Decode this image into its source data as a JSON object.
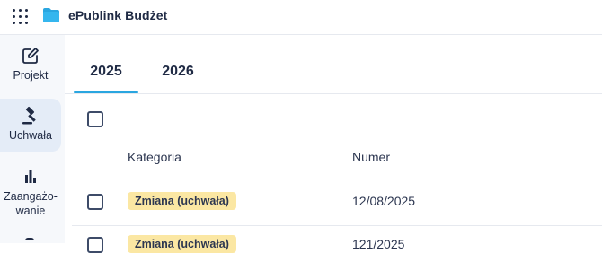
{
  "header": {
    "app_title": "ePublink Budżet",
    "apps_icon": "apps-grid-icon",
    "logo_icon": "folder-icon",
    "logo_color": "#2aa6e0"
  },
  "sidebar": {
    "items": [
      {
        "label": "Projekt",
        "icon": "edit-icon",
        "active": false
      },
      {
        "label": "Uchwała",
        "icon": "gavel-icon",
        "active": true
      },
      {
        "label": "Zaangażo-\nwanie",
        "label_line1": "Zaangażo-",
        "label_line2": "wanie",
        "icon": "bar-chart-icon",
        "active": false
      }
    ]
  },
  "tabs": [
    {
      "label": "2025",
      "active": true
    },
    {
      "label": "2026",
      "active": false
    }
  ],
  "accent_color": "#2aa6e0",
  "table": {
    "columns": [
      "Kategoria",
      "Numer"
    ],
    "rows": [
      {
        "category": "Zmiana (uchwała)",
        "number": "12/08/2025"
      },
      {
        "category": "Zmiana (uchwała)",
        "number": "121/2025"
      }
    ]
  }
}
